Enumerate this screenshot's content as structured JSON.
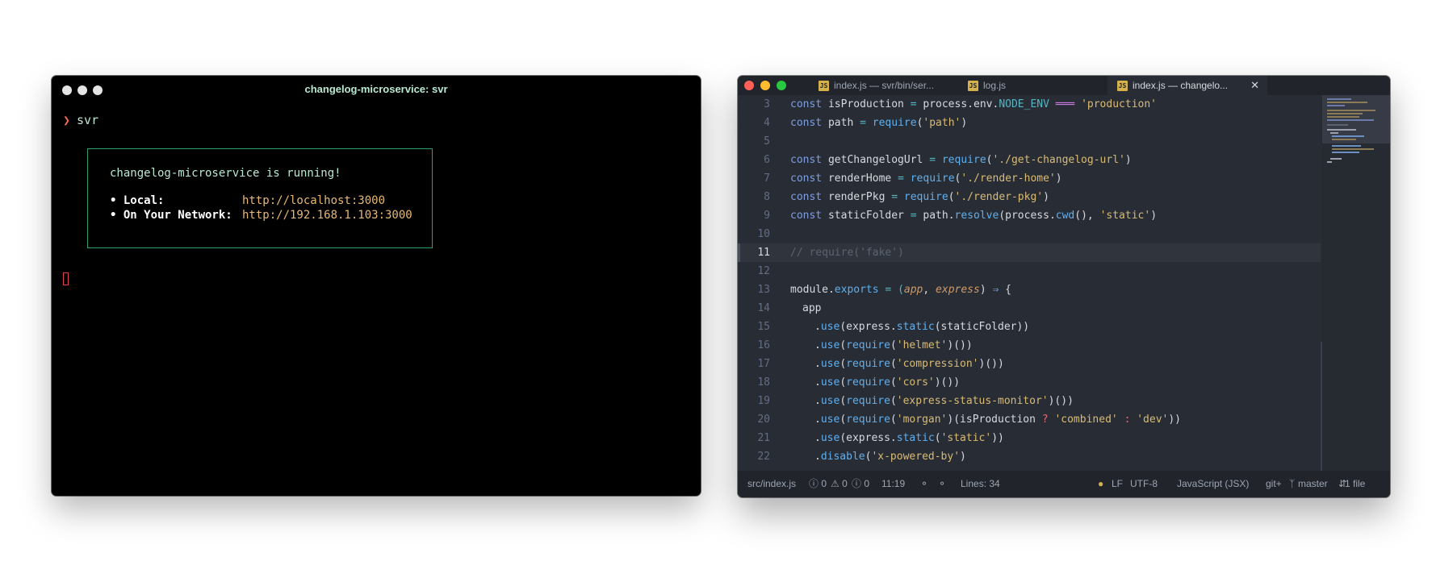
{
  "terminal": {
    "title": "changelog-microservice: svr",
    "prompt_symbol": "❯",
    "command": "svr",
    "running_message": "changelog-microservice is running!",
    "local_label": "• Local:",
    "local_url": "http://localhost:3000",
    "network_label": "• On Your Network:",
    "network_url": "http://192.168.1.103:3000"
  },
  "editor": {
    "tabs": [
      {
        "label": "index.js — svr/bin/ser...",
        "icon": "js-file-icon"
      },
      {
        "label": "log.js",
        "icon": "js-file-icon"
      },
      {
        "label": "index.js — changelo...",
        "icon": "js-file-icon",
        "active": true
      }
    ],
    "js_icon_text": "JS",
    "close_glyph": "✕",
    "code_lines": [
      {
        "n": "3"
      },
      {
        "n": "4"
      },
      {
        "n": "5"
      },
      {
        "n": "6"
      },
      {
        "n": "7"
      },
      {
        "n": "8"
      },
      {
        "n": "9"
      },
      {
        "n": "10"
      },
      {
        "n": "11"
      },
      {
        "n": "12"
      },
      {
        "n": "13"
      },
      {
        "n": "14"
      },
      {
        "n": "15"
      },
      {
        "n": "16"
      },
      {
        "n": "17"
      },
      {
        "n": "18"
      },
      {
        "n": "19"
      },
      {
        "n": "20"
      },
      {
        "n": "21"
      },
      {
        "n": "22"
      }
    ],
    "code_text": {
      "l3": [
        "const ",
        "isProduction",
        " = ",
        "process",
        ".",
        "env",
        ".",
        "NODE_ENV",
        " ═══ ",
        "'production'"
      ],
      "l4": [
        "const ",
        "path",
        " = ",
        "require",
        "(",
        "'path'",
        ")"
      ],
      "l6": [
        "const ",
        "getChangelogUrl",
        " = ",
        "require",
        "(",
        "'./get-changelog-url'",
        ")"
      ],
      "l7": [
        "const ",
        "renderHome",
        " = ",
        "require",
        "(",
        "'./render-home'",
        ")"
      ],
      "l8": [
        "const ",
        "renderPkg",
        " = ",
        "require",
        "(",
        "'./render-pkg'",
        ")"
      ],
      "l9": [
        "const ",
        "staticFolder",
        " = ",
        "path",
        ".",
        "resolve",
        "(",
        "process",
        ".",
        "cwd",
        "(), ",
        "'static'",
        ")"
      ],
      "l11": "// require('fake')",
      "l13": [
        "module",
        ".",
        "exports",
        " = (",
        "app",
        ", ",
        "express",
        ") ",
        "⇒",
        " {"
      ],
      "l14": "app",
      "l15": [
        ".",
        "use",
        "(express.",
        "static",
        "(staticFolder))"
      ],
      "l16": [
        ".",
        "use",
        "(",
        "require",
        "(",
        "'helmet'",
        ")())"
      ],
      "l17": [
        ".",
        "use",
        "(",
        "require",
        "(",
        "'compression'",
        ")())"
      ],
      "l18": [
        ".",
        "use",
        "(",
        "require",
        "(",
        "'cors'",
        ")())"
      ],
      "l19": [
        ".",
        "use",
        "(",
        "require",
        "(",
        "'express-status-monitor'",
        ")())"
      ],
      "l20": [
        ".",
        "use",
        "(",
        "require",
        "(",
        "'morgan'",
        ")(isProduction ",
        "?",
        " ",
        "'combined'",
        " ",
        ":",
        " ",
        "'dev'",
        "))"
      ],
      "l21": [
        ".",
        "use",
        "(express.",
        "static",
        "(",
        "'static'",
        "))"
      ],
      "l22": [
        ".",
        "disable",
        "(",
        "'x-powered-by'",
        ")"
      ]
    },
    "status_bar": {
      "file": "src/index.js",
      "errors": "ⓘ 0",
      "warnings": "⚠ 0",
      "infos": "ⓘ 0",
      "cursor": "11:19",
      "lines": "Lines: 34",
      "line_ending": "LF",
      "encoding": "UTF-8",
      "grammar": "JavaScript (JSX)",
      "git": "git+",
      "branch": "master",
      "files": "1 file"
    }
  },
  "colors": {
    "terminal_bg": "#000000",
    "terminal_border": "#2f9e6f",
    "url_color": "#e8b872",
    "editor_bg": "#282c34",
    "close_light": "#ff5f57",
    "minimize_light": "#febc2e",
    "zoom_light": "#28c840"
  }
}
